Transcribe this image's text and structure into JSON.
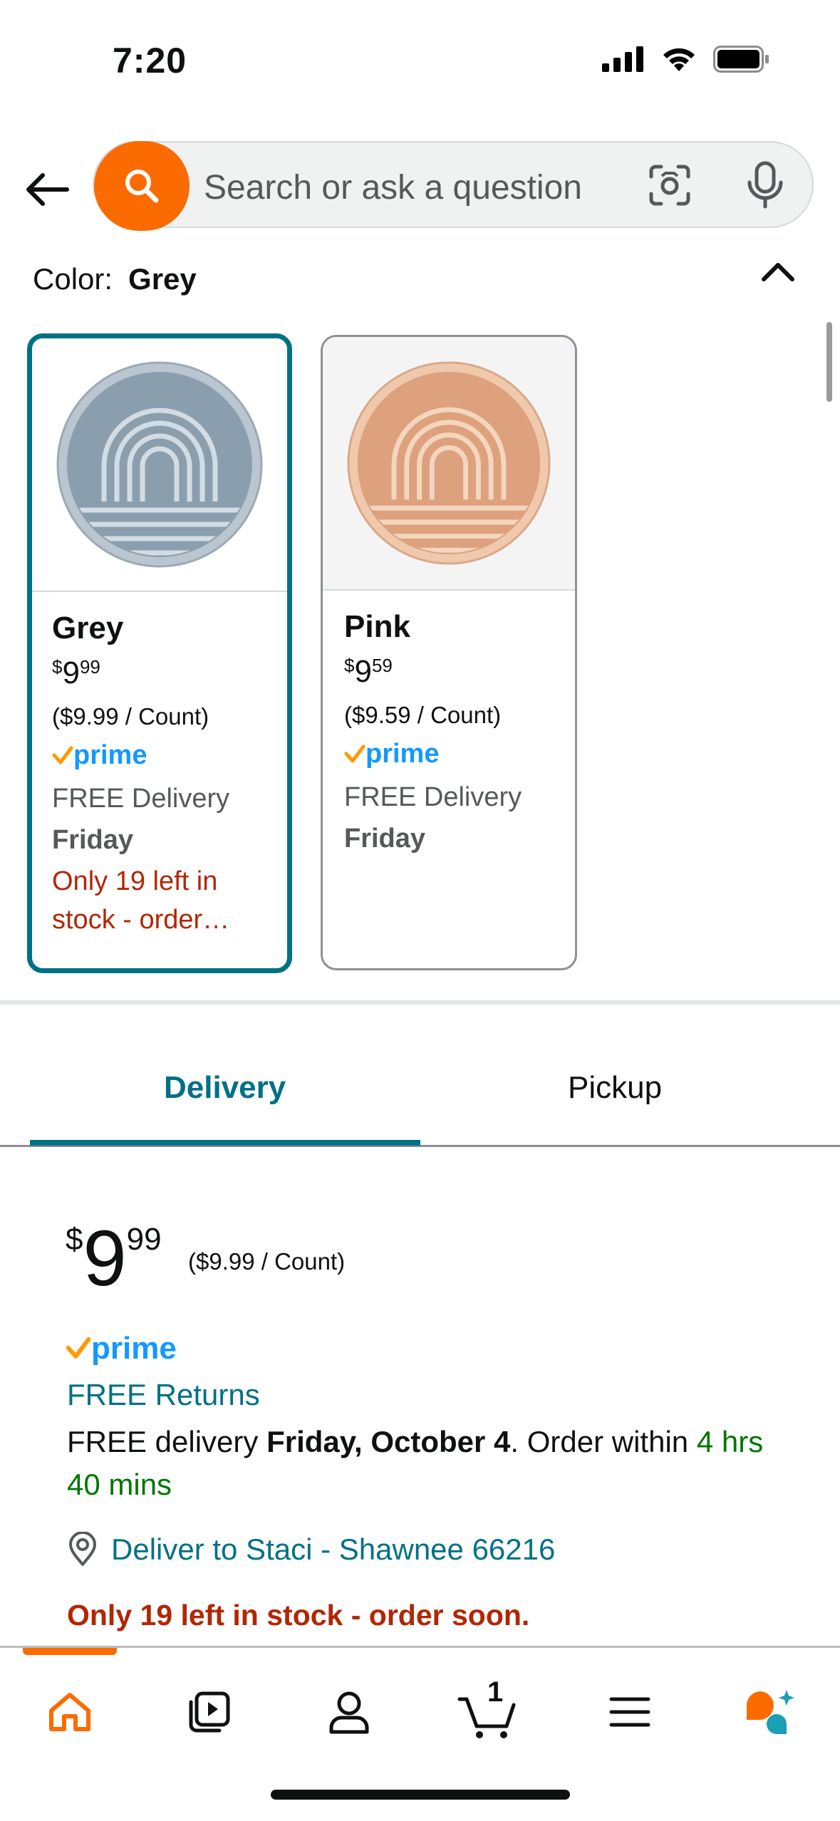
{
  "status_bar": {
    "time": "7:20"
  },
  "search": {
    "placeholder": "Search or ask a question"
  },
  "color_selector": {
    "label": "Color:",
    "selected": "Grey",
    "options": [
      {
        "name": "Grey",
        "price_currency": "$",
        "price_whole": "9",
        "price_fraction": "99",
        "unit_price": "($9.99 / Count)",
        "prime": "prime",
        "delivery": "FREE Delivery",
        "delivery_day": "Friday",
        "stock": "Only 19 left in stock - order…",
        "swatch_color": "#8fa3b3"
      },
      {
        "name": "Pink",
        "price_currency": "$",
        "price_whole": "9",
        "price_fraction": "59",
        "unit_price": "($9.59 / Count)",
        "prime": "prime",
        "delivery": "FREE Delivery",
        "delivery_day": "Friday",
        "swatch_color": "#e0a888"
      }
    ]
  },
  "tabs": {
    "delivery": "Delivery",
    "pickup": "Pickup"
  },
  "buy_box": {
    "price_currency": "$",
    "price_whole": "9",
    "price_fraction": "99",
    "unit_price": "($9.99 / Count)",
    "prime": "prime",
    "free_returns": "FREE Returns",
    "delivery_prefix": "FREE delivery ",
    "delivery_date": "Friday, October 4",
    "delivery_mid": ". Order within ",
    "delivery_countdown": "4 hrs 40 mins",
    "deliver_to": "Deliver to Staci - Shawnee 66216",
    "stock": "Only 19 left in stock - order soon."
  },
  "bottom_nav": {
    "items": [
      "home-icon",
      "video-icon",
      "account-icon",
      "cart-icon",
      "menu-icon",
      "rufus-icon"
    ],
    "cart_count": "1"
  },
  "colors": {
    "accent_orange": "#fb6b00",
    "teal": "#007185",
    "prime_blue": "#1399ff",
    "stock_red": "#b12704",
    "countdown_green": "#007600"
  }
}
